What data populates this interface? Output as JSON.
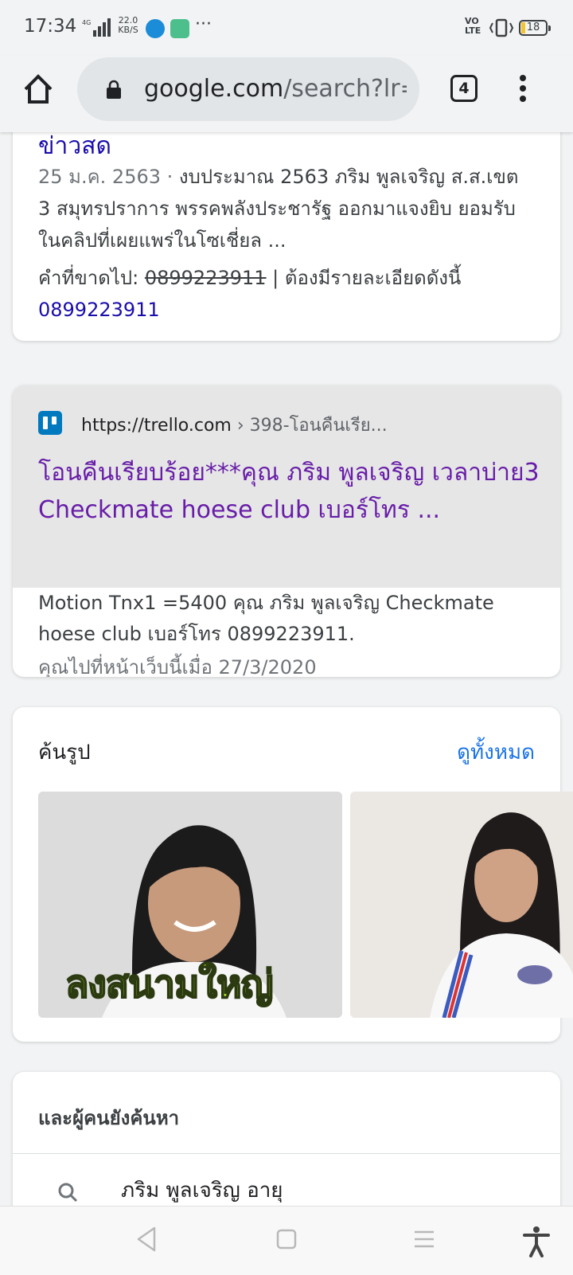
{
  "status_bar": {
    "time": "17:34",
    "network": "4G",
    "speed_value": "22.0",
    "speed_unit": "KB/S",
    "extra": "···",
    "volte": "VO\nLTE",
    "battery": "18"
  },
  "browser": {
    "url_host": "google.com",
    "url_path": "/search?lr=",
    "tab_count": "4"
  },
  "result1": {
    "title": "ข่าวสด",
    "date": "25 ม.ค. 2563",
    "sep": " · ",
    "snippet": "งบประมาณ 2563 ภริม พูลเจริญ ส.ส.เขต 3 สมุทรปราการ พรรคพลังประชารัฐ ออกมาแจงยิบ ยอมรับในคลิปที่เผยแพร่ในโซเชี่ยล ...",
    "missing_label": "คำที่ขาดไป: ",
    "missing_struck": "0899223911",
    "missing_sep": " | ",
    "missing_required": "ต้องมีรายละเอียดดังนี้",
    "missing_link": "0899223911"
  },
  "result2": {
    "site": "https://trello.com",
    "breadcrumb": " › 398-โอนคืนเรีย...",
    "title": "โอนคืนเรียบร้อย***คุณ ภริม พูลเจริญ เวลาบ่าย3 Checkmate hoese club เบอร์โทร ...",
    "snippet": "Motion Tnx1 =5400 คุณ ภริม พูลเจริญ Checkmate hoese club เบอร์โทร 0899223911.",
    "visited": "คุณไปที่หน้าเว็บนี้เมื่อ 27/3/2020"
  },
  "images": {
    "heading": "ค้นรูป",
    "see_all": "ดูทั้งหมด",
    "overlay_text": "ลงสนามใหญ่"
  },
  "people_also_search": {
    "heading": "และผู้คนยังค้นหา",
    "items": [
      "ภริม พูลเจริญ อายุ"
    ]
  },
  "colors": {
    "link": "#1a0dab",
    "visited": "#681da8",
    "accent": "#1a73e8"
  }
}
